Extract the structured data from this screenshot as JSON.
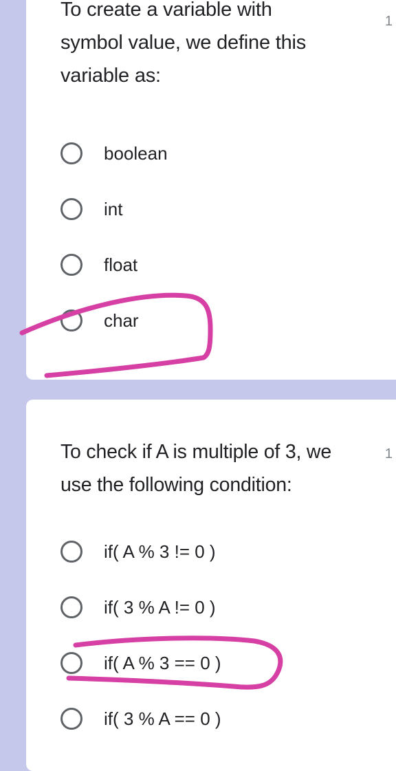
{
  "questions": [
    {
      "text": "To create a variable with\nsymbol value, we define this\nvariable as:",
      "points": "1",
      "options": [
        "boolean",
        "int",
        "float",
        "char"
      ]
    },
    {
      "text": "To check if A is multiple of 3, we\nuse the following condition:",
      "points": "1",
      "options": [
        "if( A % 3 != 0 )",
        "if( 3 % A != 0 )",
        "if( A % 3 == 0 )",
        "if( 3 % A == 0 )"
      ]
    }
  ],
  "colors": {
    "background": "#c5c8ea",
    "card": "#ffffff",
    "annotation": "#d63fa3",
    "radio": "#5f6368"
  },
  "annotations": [
    {
      "type": "hand-drawn-circle",
      "marks_option": "char"
    },
    {
      "type": "hand-drawn-circle",
      "marks_option": "if( A % 3 == 0 )"
    }
  ]
}
